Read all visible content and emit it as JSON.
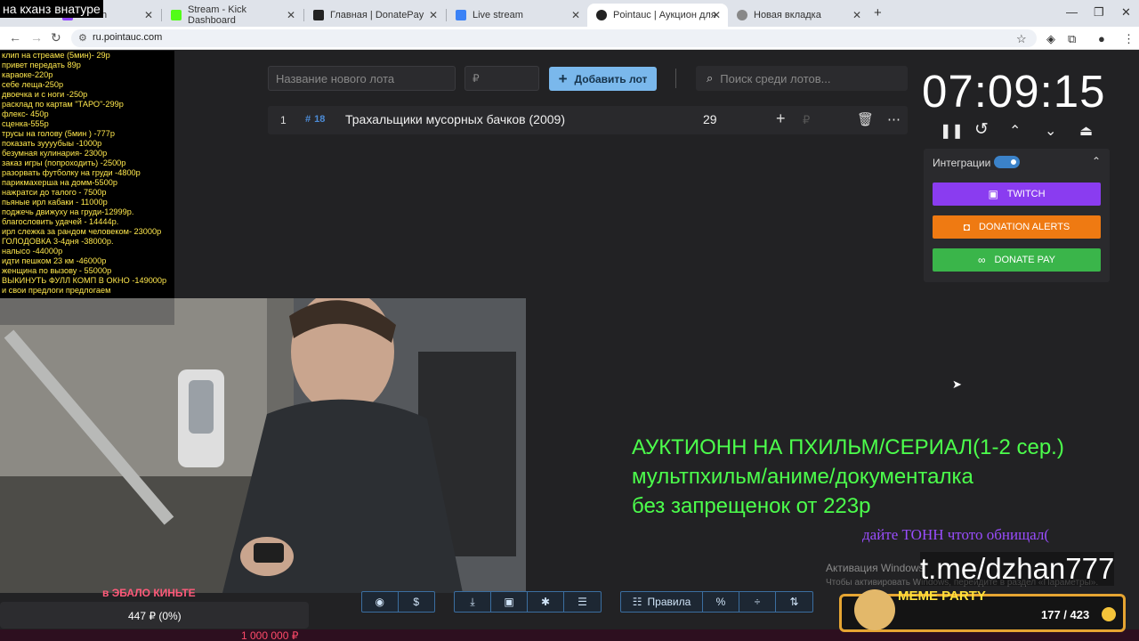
{
  "browser": {
    "tabs": [
      {
        "label": "Twitch",
        "favicon_color": "#9146ff"
      },
      {
        "label": "Stream - Kick Dashboard",
        "favicon_color": "#53fc18"
      },
      {
        "label": "Главная | DonatePay",
        "favicon_color": "#222222"
      },
      {
        "label": "Live stream",
        "favicon_color": "#3b82f6"
      },
      {
        "label": "Pointauc | Аукцион для стрима",
        "favicon_color": "#222222"
      },
      {
        "label": "Новая вкладка",
        "favicon_color": "#888888"
      }
    ],
    "new_tab": "+",
    "url": "ru.pointauc.com"
  },
  "overlay_caption": "на кханз внатуре",
  "overlay_list": [
    "клип на стреаме (5мин)- 29р",
    "привет передать 89р",
    "караоке-220р",
    "себе леща-250р",
    "двоечка и с ноги -250р",
    "расклад по картам \"ТАРО\"-299р",
    "флекс- 450р",
    "сценка-555р",
    "трусы на голову (5мин ) -777р",
    "показать зуууубыы -1000р",
    "безумная кулинария- 2300р",
    "заказ игры (попроходить) -2500р",
    "разорвать футболку на груди -4800р",
    "парикмахерша на домм-5500р",
    "нажратси до талого - 7500р",
    "пьяные ирл кабаки - 11000р",
    "поджечь движуху на груди-12999р.",
    "благословить удачей - 14444р.",
    "ирл слежка за рандом человеком- 23000р",
    "ГОЛОДОВКА 3-4дня -38000р.",
    "налысо -44000р",
    "идти пешком 23 км -46000р",
    "женщина по вызову - 55000р",
    "ВЫКИНУТЬ ФУЛЛ КОМП В ОКНО -149000р",
    "и свои предлоги предлогаем"
  ],
  "toolbar": {
    "lot_name_placeholder": "Название нового лота",
    "price_placeholder": "₽",
    "add_label": "Добавить лот",
    "search_placeholder": "Поиск среди лотов..."
  },
  "lots": [
    {
      "rank": "1",
      "id": "18",
      "title": "Трахальщики мусорных бачков (2009)",
      "amount": "29"
    }
  ],
  "timer": "07:09:15",
  "integrations": {
    "label": "Интеграции",
    "enabled": true,
    "buttons": [
      {
        "label": "TWITCH",
        "color": "#8a3cf0"
      },
      {
        "label": "DONATION ALERTS",
        "color": "#ef7a12"
      },
      {
        "label": "DONATE PAY",
        "color": "#3ab54a"
      }
    ]
  },
  "cam_caption": "в ЭБАЛО КИНЬТЕ",
  "overlay_text": {
    "line1": "АУКТИОНН НА ПХИЛЬМ/СЕРИАЛ(1-2 сер.)",
    "line2": "мультпхильм/аниме/документалка",
    "line3": "без запрещенок от 223р",
    "purple": "дайте ТОНН чтото обнищал(",
    "tme": "t.me/dzhan777"
  },
  "activation": {
    "line1": "Активация Windows",
    "line2": "Чтобы активировать Windows, перейдите в раздел «Параметры»."
  },
  "bottom_toolbar": {
    "rules_label": "Правила"
  },
  "donation_progress": {
    "text": "447 ₽ (0%)",
    "percent": 0
  },
  "goal": "1 000 000 ₽",
  "meme_party": {
    "label": "MEME PARTY",
    "count": "177 / 423"
  }
}
